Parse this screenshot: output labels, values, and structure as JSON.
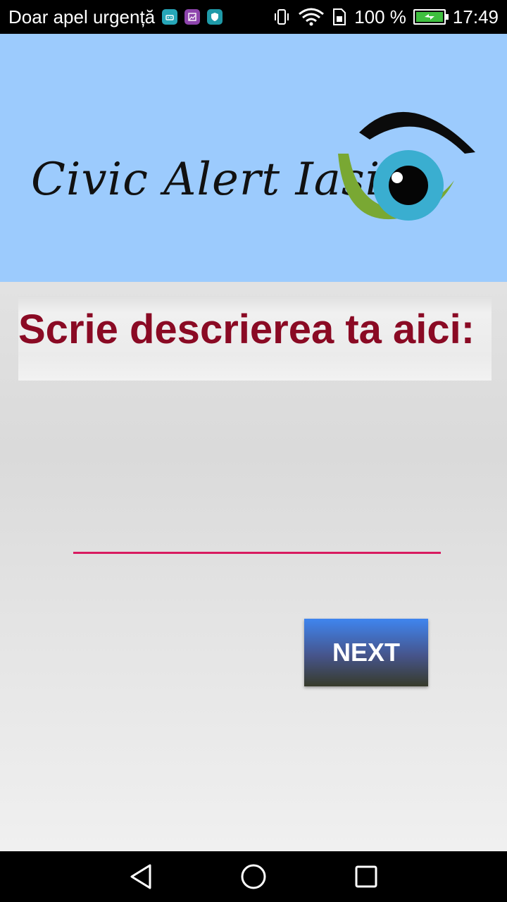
{
  "status_bar": {
    "carrier_text": "Doar apel urgență",
    "notification_icons": [
      "android-icon",
      "image-icon",
      "shield-icon"
    ],
    "icons": [
      "vibrate-icon",
      "wifi-icon",
      "sim-icon",
      "battery-icon"
    ],
    "battery_percent": "100 %",
    "battery_level": 1.0,
    "time": "17:49"
  },
  "header": {
    "logo_text": "Civic Alert Iasi",
    "background_color": "#9ccbfd"
  },
  "form": {
    "prompt_label": "Scrie descrierea ta aici:",
    "prompt_color": "#8a0a24",
    "description_input_value": "",
    "description_input_placeholder": "",
    "underline_color": "#d81b60",
    "next_button_label": "NEXT"
  },
  "nav_bar": {
    "buttons": [
      "back-icon",
      "home-icon",
      "recents-icon"
    ]
  }
}
